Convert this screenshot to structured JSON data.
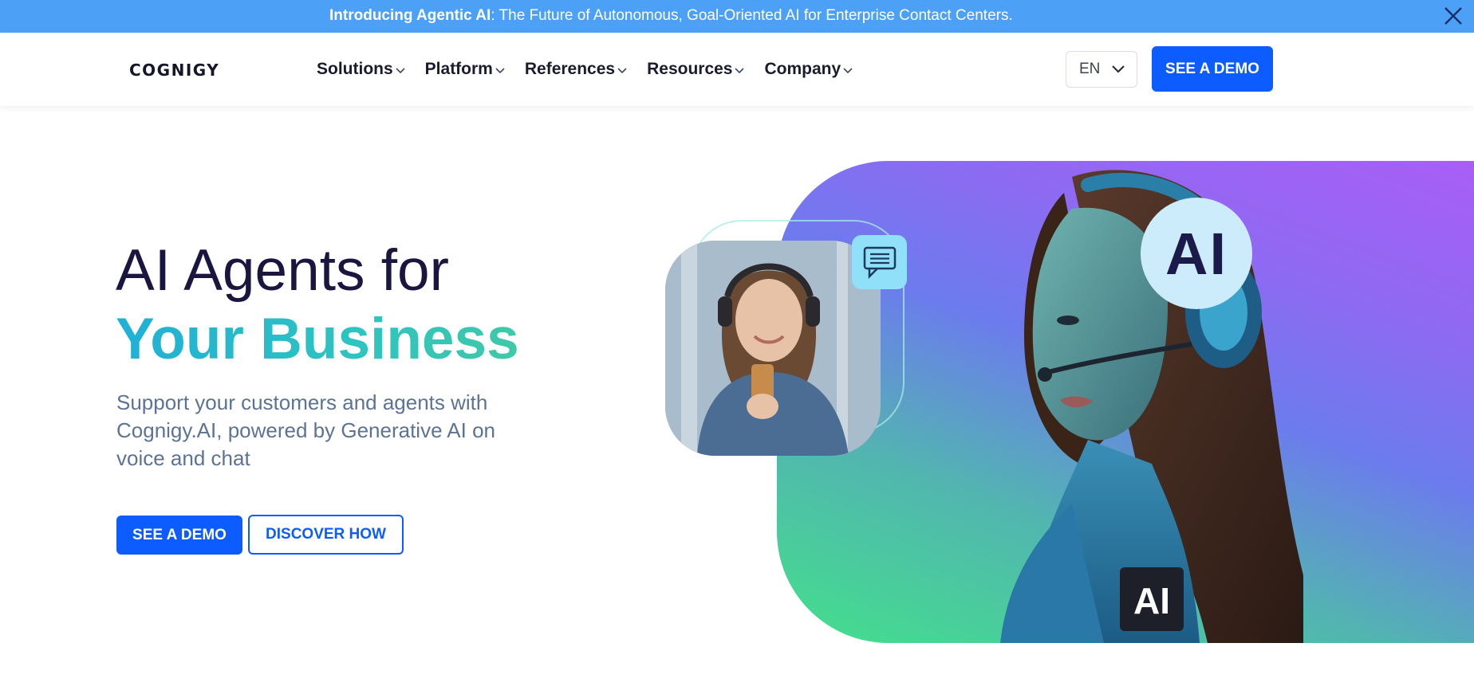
{
  "announcement": {
    "bold": "Introducing Agentic AI",
    "rest": ": The Future of Autonomous, Goal-Oriented AI for Enterprise Contact Centers.",
    "close_icon": "close-icon"
  },
  "header": {
    "logo": "COGNIGY",
    "nav": [
      {
        "label": "Solutions"
      },
      {
        "label": "Platform"
      },
      {
        "label": "References"
      },
      {
        "label": "Resources"
      },
      {
        "label": "Company"
      }
    ],
    "language": "EN",
    "demo_label": "SEE A DEMO"
  },
  "hero": {
    "title_line1": "AI Agents for",
    "title_line2": "Your Business",
    "subtitle": "Support your customers and agents with Cognigy.AI, powered by Generative AI on voice and chat",
    "primary_cta": "SEE A DEMO",
    "secondary_cta": "DISCOVER HOW",
    "ai_badge": "AI",
    "sleeve_badge": "AI"
  },
  "colors": {
    "announcement_bg": "#4ca1f7",
    "primary": "#0d5cff",
    "heading_dark": "#1a1640",
    "heading_accent": "#2ec4c0",
    "subtitle": "#5c7393"
  }
}
